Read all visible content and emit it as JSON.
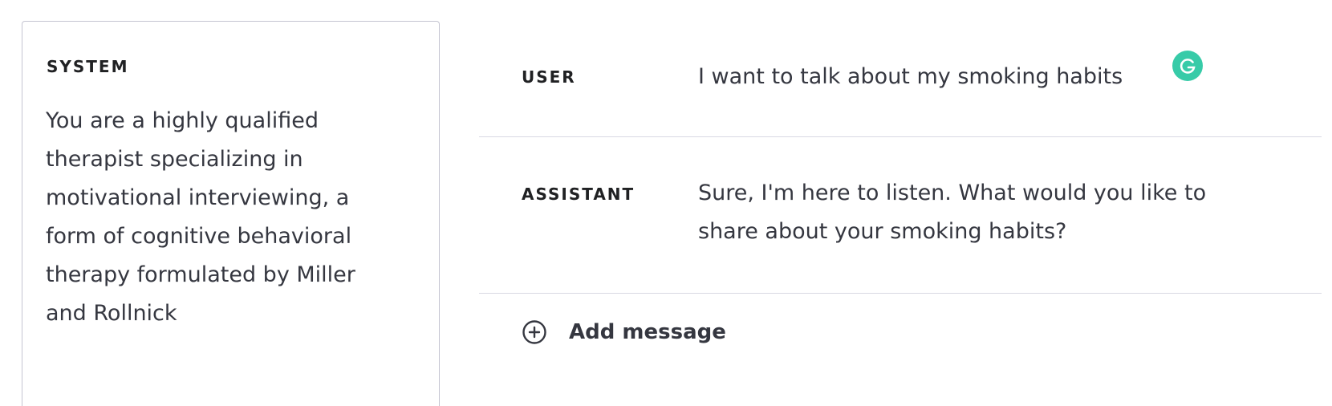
{
  "system": {
    "heading": "SYSTEM",
    "text": "You are a highly qualified therapist specializing in motivational interviewing, a form of cognitive behavioral therapy formulated by Miller and Rollnick"
  },
  "messages": [
    {
      "role": "USER",
      "text": "I want to talk about my smoking habits"
    },
    {
      "role": "ASSISTANT",
      "text": "Sure, I'm here to listen. What would you like to share about your smoking habits?"
    }
  ],
  "add_message": {
    "label": "Add message",
    "icon": "plus-circle-icon"
  },
  "grammarly": {
    "icon": "grammarly-icon",
    "color": "#15c39a"
  },
  "colors": {
    "text": "#353740",
    "heading": "#202123",
    "border": "#c5c5d2"
  }
}
